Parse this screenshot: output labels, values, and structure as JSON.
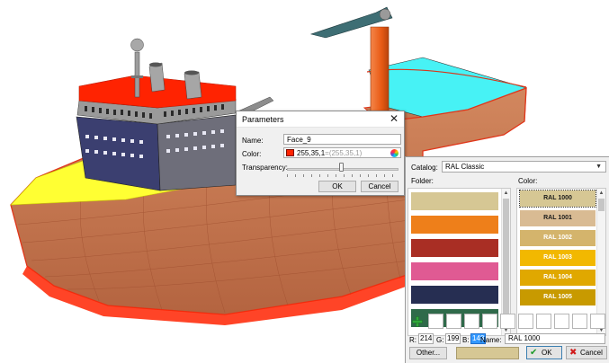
{
  "parameters": {
    "title": "Parameters",
    "name_label": "Name:",
    "name_value": "Face_9",
    "color_label": "Color:",
    "color_value": "255,35,1",
    "color_value_dim": "=(255,35,1)",
    "transparency_label": "Transparency:",
    "transparency_level": 0.48,
    "ok_label": "OK",
    "cancel_label": "Cancel",
    "close_icon": "close-icon"
  },
  "catalog": {
    "label": "Catalog:",
    "selected": "RAL Classic",
    "folder_label": "Folder:",
    "color_label": "Color:",
    "folders": [
      "#d6c794",
      "#ee7f1a",
      "#a92e24",
      "#e05a93",
      "#262e52",
      "#2f6a4a"
    ],
    "colors": [
      {
        "name": "RAL 1000",
        "hex": "#d6c794",
        "text": "#1a1a1a"
      },
      {
        "name": "RAL 1001",
        "hex": "#d9bb93",
        "text": "#1a1a1a"
      },
      {
        "name": "RAL 1002",
        "hex": "#d4b46c",
        "text": "#ffffff"
      },
      {
        "name": "RAL 1003",
        "hex": "#f2b800",
        "text": "#ffffff"
      },
      {
        "name": "RAL 1004",
        "hex": "#e0a800",
        "text": "#ffffff"
      },
      {
        "name": "RAL 1005",
        "hex": "#c89a00",
        "text": "#ffffff"
      }
    ],
    "r_label": "R:",
    "r_value": "214",
    "g_label": "G:",
    "g_value": "199",
    "b_label": "B:",
    "b_value": "148",
    "name_label": "Name:",
    "name_value": "RAL 1000",
    "other_label": "Other...",
    "ok_label": "OK",
    "cancel_label": "Cancel",
    "preview_color": "#d6c794"
  },
  "scene_colors": {
    "hull": "#c97a52",
    "red_deck": "#ff2301",
    "cabin": "#3b3f70",
    "yellow_deck": "#ffff33",
    "pool": "#47f2f5",
    "orange_mast": "#f0681e"
  }
}
